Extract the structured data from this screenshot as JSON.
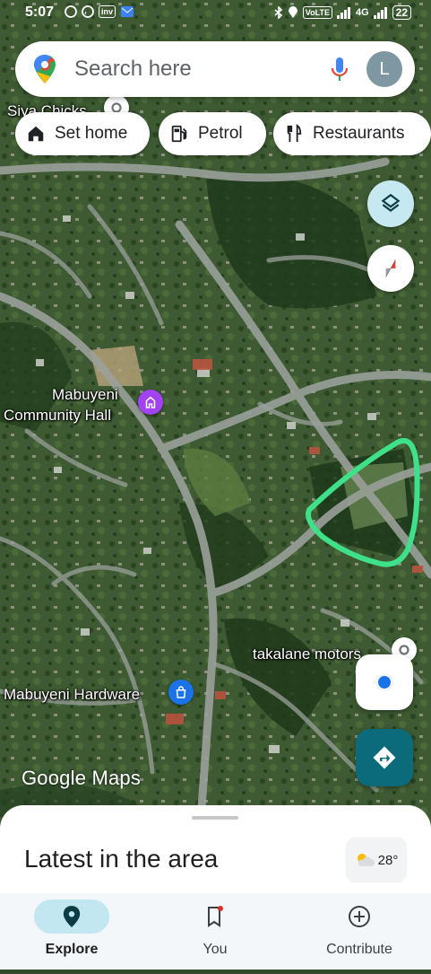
{
  "status_bar": {
    "time": "5:07",
    "battery": "22",
    "network": "4G",
    "volte": "VoLTE"
  },
  "search": {
    "placeholder": "Search here",
    "avatar_letter": "L"
  },
  "chips": [
    {
      "label": "Set home",
      "icon": "home-icon"
    },
    {
      "label": "Petrol",
      "icon": "gas-station-icon"
    },
    {
      "label": "Restaurants",
      "icon": "restaurant-icon"
    }
  ],
  "map": {
    "labels": {
      "siya_chicks": "Siya Chicks",
      "community_hall_line1": "Mabuyeni",
      "community_hall_line2": "Community Hall",
      "hardware": "Mabuyeni Hardware",
      "motors": "takalane motors"
    },
    "watermark": "Google Maps",
    "annotation_color": "#3ee08a"
  },
  "bottom_sheet": {
    "title": "Latest in the area",
    "temperature": "28°"
  },
  "nav": [
    {
      "label": "Explore",
      "icon": "explore-pin-icon",
      "active": true
    },
    {
      "label": "You",
      "icon": "bookmark-icon",
      "active": false
    },
    {
      "label": "Contribute",
      "icon": "add-circle-icon",
      "active": false
    }
  ],
  "colors": {
    "accent_teal": "#0b6b7a",
    "location_blue": "#1a73e8",
    "nav_active_bg": "#c2e7f0"
  }
}
